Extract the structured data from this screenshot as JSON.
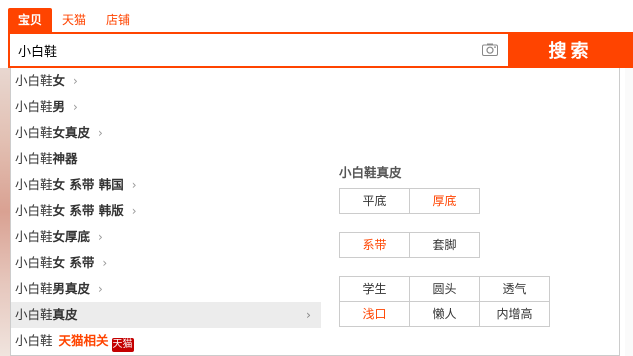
{
  "tabs": [
    {
      "label": "宝贝",
      "active": true
    },
    {
      "label": "天猫",
      "active": false
    },
    {
      "label": "店铺",
      "active": false
    }
  ],
  "search": {
    "value": "小白鞋",
    "button_label": "搜索"
  },
  "colors": {
    "accent": "#ff4400",
    "tmall_red": "#c40000"
  },
  "suggestions": [
    {
      "query": "小白鞋",
      "rest": "女",
      "has_chevron": true
    },
    {
      "query": "小白鞋",
      "rest": "男",
      "has_chevron": true
    },
    {
      "query": "小白鞋",
      "rest": "女真皮",
      "has_chevron": true
    },
    {
      "query": "小白鞋",
      "rest": "神器",
      "has_chevron": false
    },
    {
      "query": "小白鞋",
      "rest": "女 系带 韩国",
      "has_chevron": true
    },
    {
      "query": "小白鞋",
      "rest": "女 系带 韩版",
      "has_chevron": true
    },
    {
      "query": "小白鞋",
      "rest": "女厚底",
      "has_chevron": true
    },
    {
      "query": "小白鞋",
      "rest": "女 系带",
      "has_chevron": true
    },
    {
      "query": "小白鞋",
      "rest": "男真皮",
      "has_chevron": true
    },
    {
      "query": "小白鞋",
      "rest": "真皮",
      "has_chevron": true,
      "highlighted": true
    },
    {
      "query": "小白鞋",
      "rest": "天猫相关",
      "tmall": true,
      "tmall_icon": "天猫"
    }
  ],
  "panel": {
    "title": "小白鞋真皮",
    "group1": [
      {
        "label": "平底",
        "highlight": false
      },
      {
        "label": "厚底",
        "highlight": true
      }
    ],
    "group2": [
      {
        "label": "系带",
        "highlight": true
      },
      {
        "label": "套脚",
        "highlight": false
      }
    ],
    "group3": [
      {
        "label": "学生",
        "highlight": false
      },
      {
        "label": "圆头",
        "highlight": false
      },
      {
        "label": "透气",
        "highlight": false
      },
      {
        "label": "浅口",
        "highlight": true
      },
      {
        "label": "懒人",
        "highlight": false
      },
      {
        "label": "内增高",
        "highlight": false
      }
    ]
  }
}
